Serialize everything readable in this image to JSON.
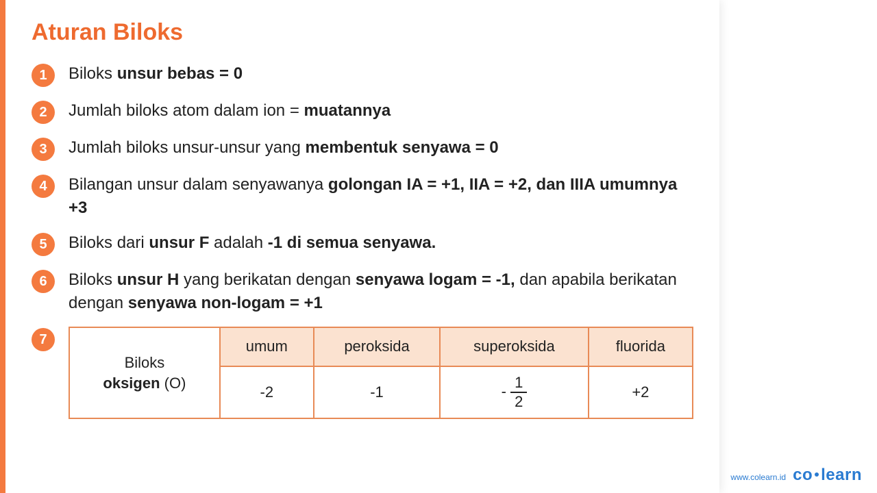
{
  "title": "Aturan Biloks",
  "rules": {
    "r1_pre": "Biloks ",
    "r1_b": "unsur bebas = 0",
    "r2_pre": "Jumlah biloks atom dalam ion = ",
    "r2_b": "muatannya",
    "r3_pre": "Jumlah biloks unsur-unsur yang ",
    "r3_b": "membentuk senyawa = 0",
    "r4_pre": "Bilangan unsur dalam senyawanya ",
    "r4_b1": "golongan IA = +1, IIA = +2, dan IIIA umumnya +3",
    "r5_pre": "Biloks dari ",
    "r5_b1": "unsur F",
    "r5_mid": " adalah ",
    "r5_b2": "-1 di semua senyawa.",
    "r6_pre": "Biloks ",
    "r6_b1": "unsur H",
    "r6_mid1": " yang berikatan dengan ",
    "r6_b2": "senyawa logam = -1,",
    "r6_mid2": " dan apabila berikatan dengan ",
    "r6_b3": "senyawa non-logam = +1"
  },
  "nums": {
    "n1": "1",
    "n2": "2",
    "n3": "3",
    "n4": "4",
    "n5": "5",
    "n6": "6",
    "n7": "7"
  },
  "table": {
    "row_label_pre": "Biloks ",
    "row_label_b": "oksigen",
    "row_label_post": " (O)",
    "headers": {
      "h1": "umum",
      "h2": "peroksida",
      "h3": "superoksida",
      "h4": "fluorida"
    },
    "values": {
      "v1": "-2",
      "v2": "-1",
      "v3_neg": "- ",
      "v3_num": "1",
      "v3_den": "2",
      "v4": "+2"
    }
  },
  "footer": {
    "url": "www.colearn.id",
    "brand_a": "co",
    "brand_b": "learn"
  }
}
